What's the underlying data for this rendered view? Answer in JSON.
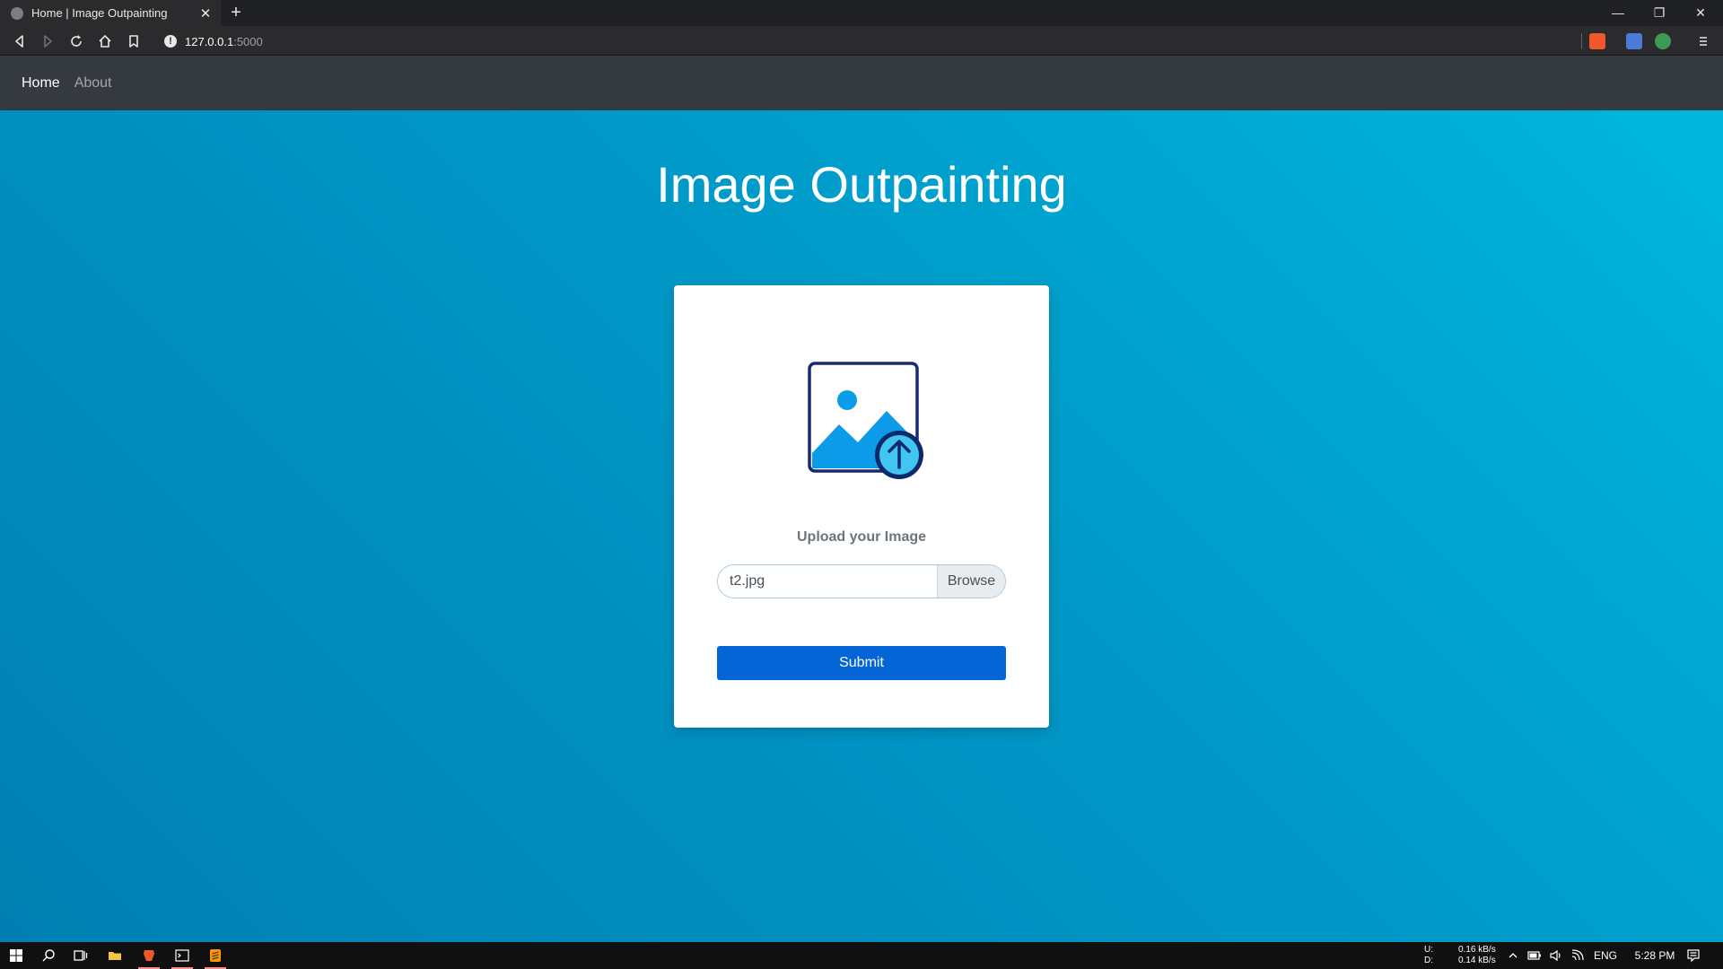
{
  "browser": {
    "tab_title": "Home | Image Outpainting",
    "tab_close": "✕",
    "new_tab": "+",
    "url_host": "127.0.0.1",
    "url_port": ":5000",
    "window_controls": {
      "minimize": "—",
      "restore": "❐",
      "close": "✕"
    }
  },
  "navbar": {
    "links": [
      {
        "label": "Home",
        "active": true
      },
      {
        "label": "About",
        "active": false
      }
    ]
  },
  "main": {
    "title": "Image Outpainting",
    "upload_label": "Upload your Image",
    "file_value": "t2.jpg",
    "browse_label": "Browse",
    "submit_label": "Submit"
  },
  "taskbar": {
    "net_upload_label": "U:",
    "net_download_label": "D:",
    "net_upload": "0.16 kB/s",
    "net_download": "0.14 kB/s",
    "language": "ENG",
    "time": "5:28 PM"
  },
  "colors": {
    "accent": "#0465d6",
    "navbar": "#343a40",
    "page_gradient_start": "#00b8de",
    "page_gradient_end": "#0080b2"
  }
}
